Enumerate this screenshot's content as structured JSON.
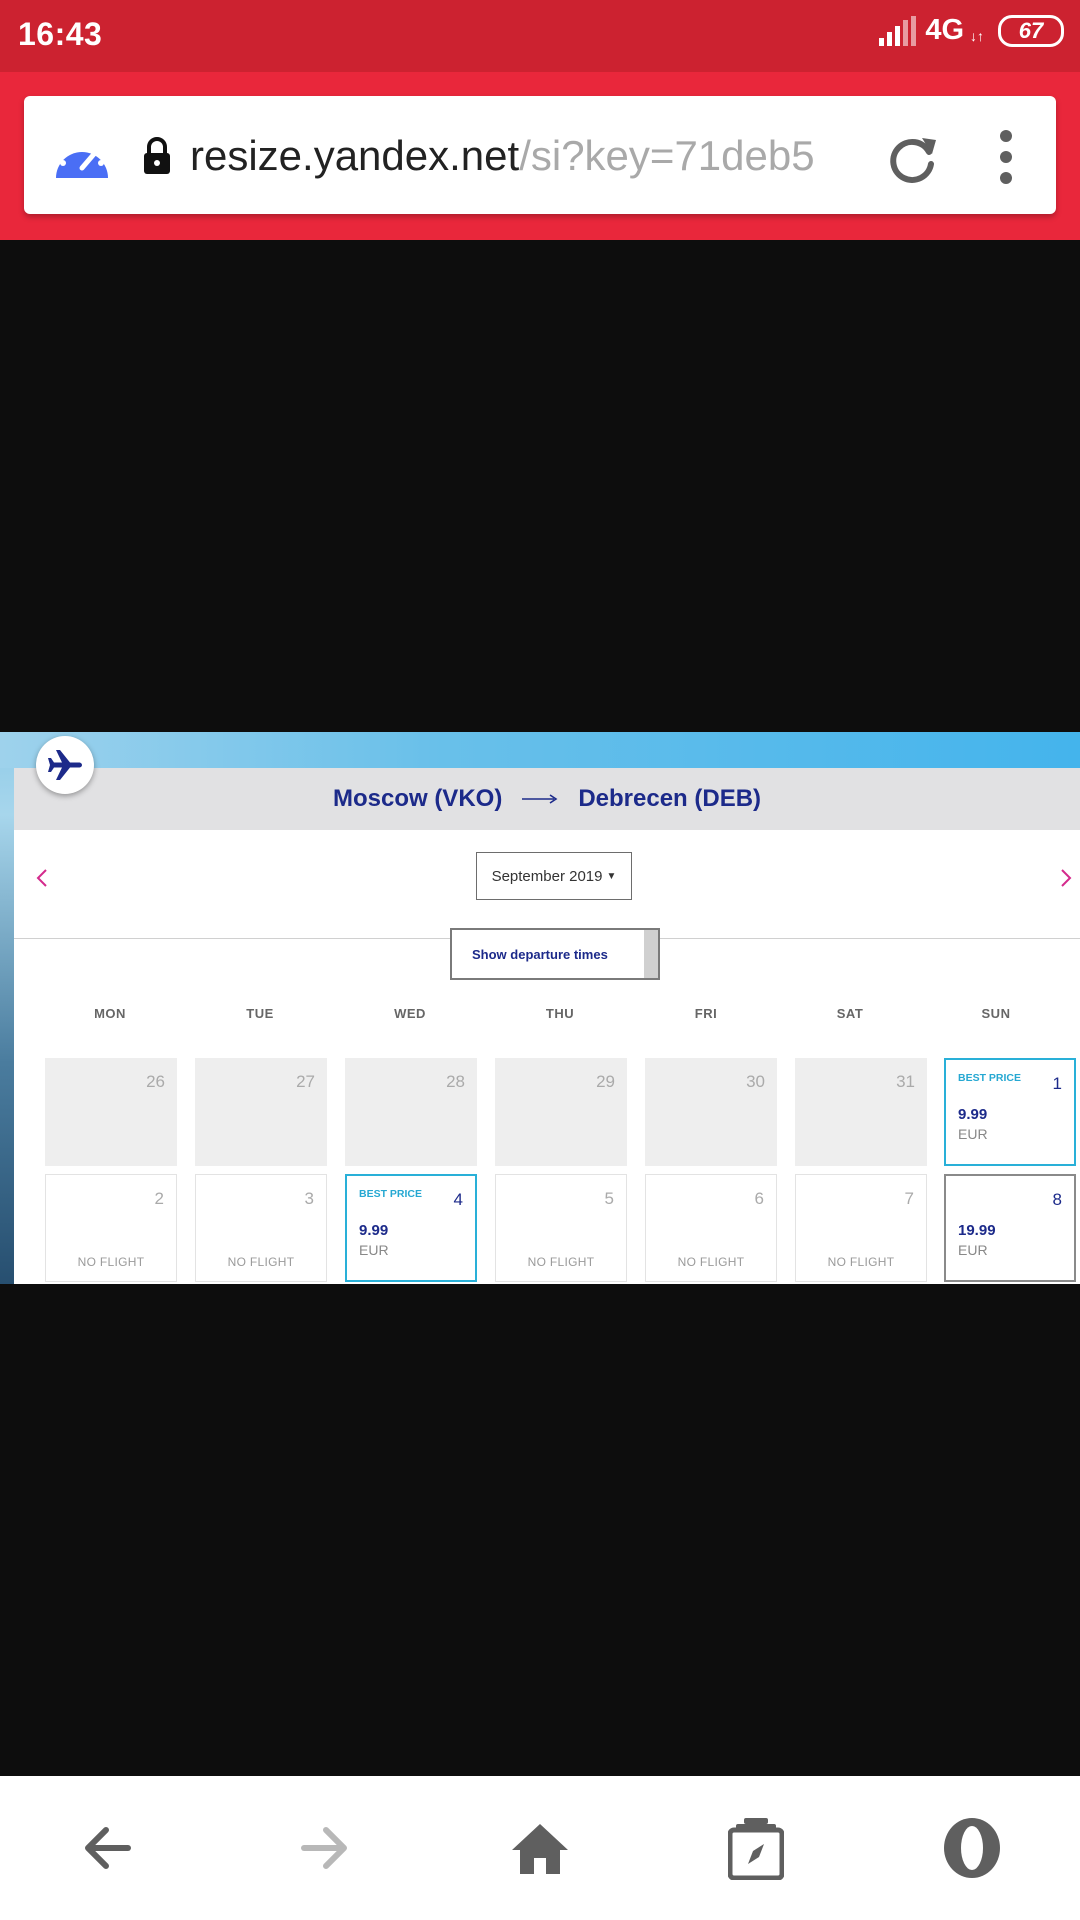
{
  "status_bar": {
    "time": "16:43",
    "network": "4G",
    "network_activity": "↓↑",
    "battery": "67"
  },
  "browser": {
    "url_host": "resize.yandex.net",
    "url_path": "/si?key=71deb5",
    "icons": [
      "speed-dial-icon",
      "lock-icon",
      "reload-icon",
      "more-vert-icon"
    ]
  },
  "flight_calendar": {
    "route": {
      "origin": "Moscow (VKO)",
      "destination": "Debrecen (DEB)"
    },
    "month_select": "September 2019",
    "show_times_label": "Show departure times",
    "weekdays": [
      "MON",
      "TUE",
      "WED",
      "THU",
      "FRI",
      "SAT",
      "SUN"
    ],
    "weeks": [
      [
        {
          "day": "26",
          "state": "past"
        },
        {
          "day": "27",
          "state": "past"
        },
        {
          "day": "28",
          "state": "past"
        },
        {
          "day": "29",
          "state": "past"
        },
        {
          "day": "30",
          "state": "past"
        },
        {
          "day": "31",
          "state": "past"
        },
        {
          "day": "1",
          "state": "best",
          "badge": "BEST PRICE",
          "price": "9.99",
          "currency": "EUR"
        }
      ],
      [
        {
          "day": "2",
          "state": "noflight",
          "label": "NO FLIGHT"
        },
        {
          "day": "3",
          "state": "noflight",
          "label": "NO FLIGHT"
        },
        {
          "day": "4",
          "state": "best",
          "badge": "BEST PRICE",
          "price": "9.99",
          "currency": "EUR"
        },
        {
          "day": "5",
          "state": "noflight",
          "label": "NO FLIGHT"
        },
        {
          "day": "6",
          "state": "noflight",
          "label": "NO FLIGHT"
        },
        {
          "day": "7",
          "state": "noflight",
          "label": "NO FLIGHT"
        },
        {
          "day": "8",
          "state": "priced",
          "price": "19.99",
          "currency": "EUR"
        }
      ]
    ]
  },
  "bottom_nav": [
    "back-icon",
    "forward-icon",
    "home-icon",
    "tabs-icon",
    "opera-menu-icon"
  ],
  "colors": {
    "status_bar": "#cc2230",
    "browser_bar": "#e9273b",
    "navy_text": "#1c2a8a",
    "best_price_accent": "#29b0d8",
    "nav_arrow": "#d42a8c"
  }
}
